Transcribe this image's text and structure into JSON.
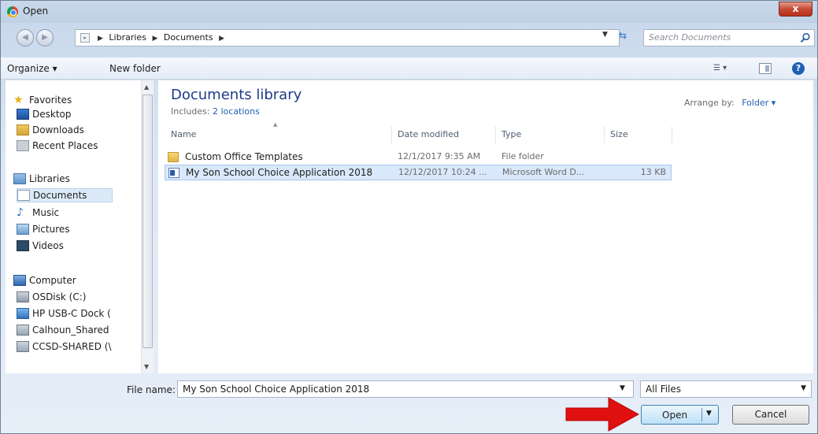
{
  "window": {
    "title": "Open",
    "close_glyph": "x"
  },
  "address": {
    "crumbs": [
      "Libraries",
      "Documents"
    ],
    "search_placeholder": "Search Documents"
  },
  "toolbar": {
    "organize_label": "Organize ▾",
    "new_folder_label": "New folder",
    "help_glyph": "?"
  },
  "sidebar": {
    "favorites_header": "Favorites",
    "favorites": [
      "Desktop",
      "Downloads",
      "Recent Places"
    ],
    "libraries_header": "Libraries",
    "libraries": [
      "Documents",
      "Music",
      "Pictures",
      "Videos"
    ],
    "computer_header": "Computer",
    "computer": [
      "OSDisk (C:)",
      "HP USB-C Dock (",
      "Calhoun_Shared",
      "CCSD-SHARED (\\"
    ],
    "selected": "Documents"
  },
  "library": {
    "title": "Documents library",
    "includes_label": "Includes:",
    "includes_link": "2 locations",
    "arrange_label": "Arrange by:",
    "arrange_value": "Folder ▾"
  },
  "columns": [
    "Name",
    "Date modified",
    "Type",
    "Size"
  ],
  "files": [
    {
      "name": "Custom Office Templates",
      "date": "12/1/2017 9:35 AM",
      "type": "File folder",
      "size": "",
      "icon": "folder-icon"
    },
    {
      "name": "My Son School Choice Application 2018",
      "date": "12/12/2017 10:24 ...",
      "type": "Microsoft Word D...",
      "size": "13 KB",
      "icon": "word-doc-icon"
    }
  ],
  "bottom": {
    "file_name_label": "File name:",
    "file_name_value": "My Son School Choice Application 2018",
    "filter_value": "All Files",
    "open_label": "Open",
    "cancel_label": "Cancel"
  },
  "colors": {
    "title_text": "#1e3a8a",
    "link": "#1f5eb6",
    "selection": "#d9e8fa",
    "arrow": "#e01010"
  }
}
